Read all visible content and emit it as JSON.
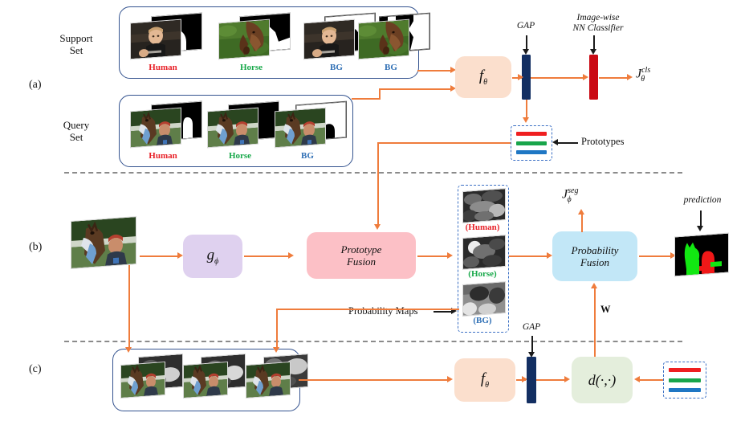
{
  "figure": {
    "rows": [
      {
        "id": "a",
        "label": "(a)"
      },
      {
        "id": "b",
        "label": "(b)"
      },
      {
        "id": "c",
        "label": "(c)"
      }
    ]
  },
  "row_a": {
    "support_set_label": "Support\nSet",
    "support_set_label_line1": "Support",
    "support_set_label_line2": "Set",
    "query_set_label_line1": "Query",
    "query_set_label_line2": "Set",
    "support_items": [
      {
        "class_label": "Human",
        "color": "#e8232a",
        "scene": "human"
      },
      {
        "class_label": "Horse",
        "color": "#17a849",
        "scene": "horse"
      },
      {
        "class_label": "BG",
        "color": "#2f6fb5",
        "scene": "human"
      },
      {
        "class_label": "BG",
        "color": "#2f6fb5",
        "scene": "horse"
      }
    ],
    "query_items": [
      {
        "class_label": "Human",
        "color": "#e8232a",
        "scene": "jockey"
      },
      {
        "class_label": "Horse",
        "color": "#17a849",
        "scene": "jockey"
      },
      {
        "class_label": "BG",
        "color": "#2f6fb5",
        "scene": "jockey"
      }
    ],
    "encoder_label": "f",
    "encoder_sub": "θ",
    "gap_label": "GAP",
    "classifier_label_line1": "Image-wise",
    "classifier_label_line2": "NN Classifier",
    "loss_label": "J",
    "loss_sub": "θ",
    "loss_sup": "cls",
    "prototypes_label": "Prototypes",
    "prototype_colors": [
      "#ef1f20",
      "#18a54a",
      "#1f77c4"
    ]
  },
  "row_b": {
    "gphi_label": "g",
    "gphi_sub": "ϕ",
    "prototype_fusion_line1": "Prototype",
    "prototype_fusion_line2": "Fusion",
    "probability_maps_label": "Probability Maps",
    "prob_maps": [
      {
        "label": "(Human)",
        "color": "#e8232a"
      },
      {
        "label": "(Horse)",
        "color": "#17a849"
      },
      {
        "label": "(BG)",
        "color": "#2f6fb5"
      }
    ],
    "probability_fusion_line1": "Probability",
    "probability_fusion_line2": "Fusion",
    "loss_label": "J",
    "loss_sub": "ϕ",
    "loss_sup": "seg",
    "prediction_label": "prediction",
    "weight_label": "W"
  },
  "row_c": {
    "items_count": 3,
    "encoder_label": "f",
    "encoder_sub": "θ",
    "gap_label": "GAP",
    "distance_label": "d(·,·)",
    "prototype_colors": [
      "#ef1f20",
      "#18a54a",
      "#1f77c4"
    ]
  },
  "colors": {
    "arrow": "#ef7c3c",
    "set_border": "#34538f",
    "dashed_border": "#3a6fc4",
    "divider": "#8b8b8b",
    "encoder_box": "#fbdfcd",
    "gphi_box": "#dfd1ef",
    "prototype_fusion_box": "#fcc0c6",
    "probability_fusion_box": "#c2e7f7",
    "distance_box": "#e4eedc",
    "gap_bar": "#132f62",
    "nn_bar": "#ca0a14"
  }
}
